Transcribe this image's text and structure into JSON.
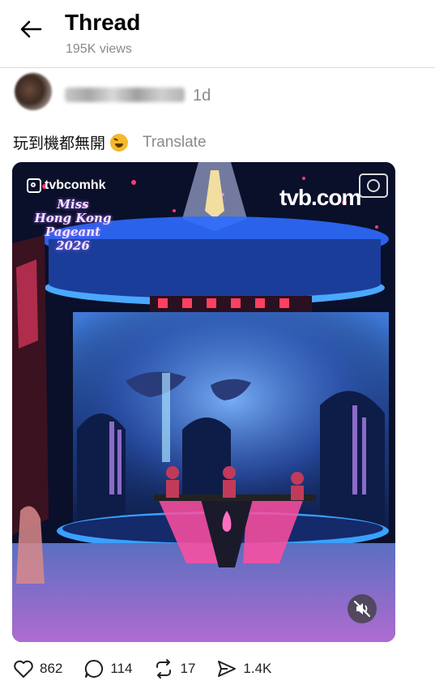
{
  "header": {
    "title": "Thread",
    "views": "195K views"
  },
  "post": {
    "timestamp": "1d",
    "text": "玩到機都無開",
    "emoji": "grinning-squinting-face",
    "translate_label": "Translate",
    "media": {
      "ig_handle": "tvbcomhk",
      "logo_line1": "Miss",
      "logo_line2": "Hong Kong",
      "logo_line3": "Pageant",
      "logo_line4": "2026",
      "watermark": "tvb.com",
      "muted": true
    }
  },
  "actions": {
    "likes": "862",
    "replies": "114",
    "reposts": "17",
    "shares": "1.4K"
  },
  "colors": {
    "muted_text": "#8a8a8a",
    "stage_blue": "#2f6bff",
    "stage_pink": "#ff4fa0"
  }
}
